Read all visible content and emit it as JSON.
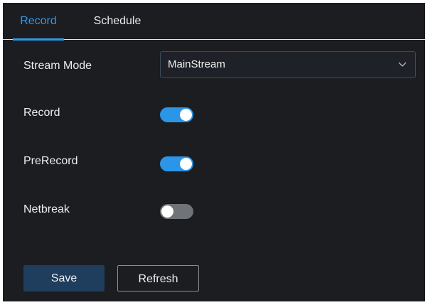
{
  "tabs": [
    {
      "label": "Record",
      "active": true
    },
    {
      "label": "Schedule",
      "active": false
    }
  ],
  "form": {
    "stream_mode": {
      "label": "Stream Mode",
      "value": "MainStream"
    },
    "record": {
      "label": "Record",
      "enabled": true
    },
    "prerecord": {
      "label": "PreRecord",
      "enabled": true
    },
    "netbreak": {
      "label": "Netbreak",
      "enabled": false
    }
  },
  "buttons": {
    "save_label": "Save",
    "refresh_label": "Refresh"
  },
  "icons": {
    "dropdown": "chevron-down-icon"
  },
  "colors": {
    "accent": "#2f99e8",
    "toggle_on": "#2b96e8",
    "toggle_off": "#707377",
    "background": "#1c1d21",
    "save_button": "#1f3d5d"
  }
}
